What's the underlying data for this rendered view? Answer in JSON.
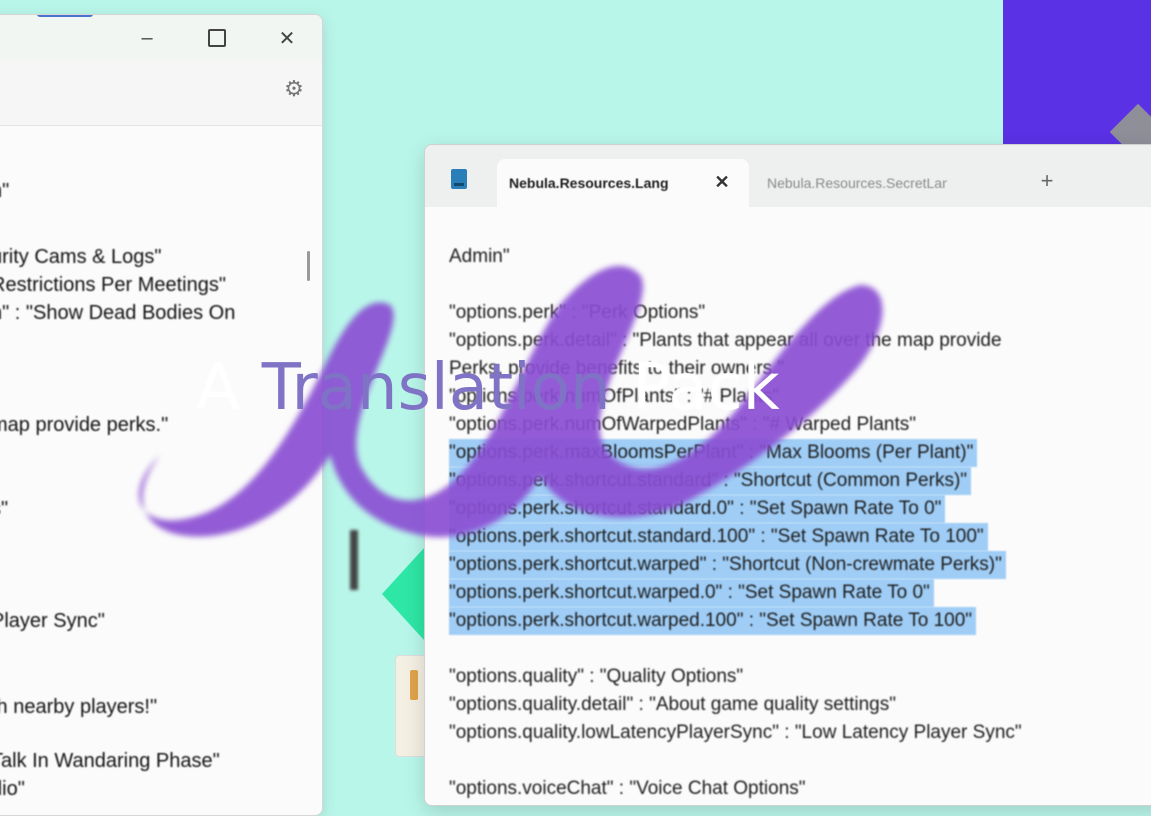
{
  "decor_colors": {
    "background": "#b9f6ea",
    "brush": "#8a4ed3",
    "corner": "#5a31e4"
  },
  "left_window": {
    "minimize_icon": "minimize-icon",
    "maximize_icon": "maximize-icon",
    "close_icon": "close-icon",
    "settings_icon": "gear-icon",
    "lines": [
      "n\"",
      "urity Cams & Logs\"",
      " Restrictions Per Meetings\"",
      "n\" : \"Show Dead Bodies On",
      "map provide perks.\"",
      "s\"",
      "",
      "Player Sync\"",
      "th nearby players!\"",
      "Talk In Wandaring Phase\"",
      "dio\""
    ]
  },
  "right_window": {
    "tabs": [
      {
        "label": "Nebula.Resources.Lang",
        "active": true
      },
      {
        "label": "Nebula.Resources.SecretLang",
        "active": false
      }
    ],
    "add_tab_icon": "plus-icon",
    "lines": [
      {
        "text": "Admin\"",
        "selected": false
      },
      {
        "text": "",
        "selected": false
      },
      {
        "text": "\"options.perk\" : \"Perk Options\"",
        "selected": false
      },
      {
        "text": "\"options.perk.detail\" : \"Plants that appear all over the map provide",
        "selected": false
      },
      {
        "text": "Perks, provide benefits to their owners.\"",
        "selected": false
      },
      {
        "text": "\"options.perk.numOfPlants\" : \"# Plants\"",
        "selected": false
      },
      {
        "text": "\"options.perk.numOfWarpedPlants\" : \"# Warped Plants\"",
        "selected": false
      },
      {
        "text": "\"options.perk.maxBloomsPerPlant\" : \"Max Blooms (Per Plant)\"",
        "selected": true
      },
      {
        "text": "\"options.perk.shortcut.standard\" : \"Shortcut (Common Perks)\"",
        "selected": true
      },
      {
        "text": "\"options.perk.shortcut.standard.0\" : \"Set Spawn Rate To 0\"",
        "selected": true
      },
      {
        "text": "\"options.perk.shortcut.standard.100\" : \"Set Spawn Rate To 100\"",
        "selected": true
      },
      {
        "text": "\"options.perk.shortcut.warped\" : \"Shortcut (Non-crewmate Perks)\"",
        "selected": true
      },
      {
        "text": "\"options.perk.shortcut.warped.0\" : \"Set Spawn Rate To 0\"",
        "selected": true
      },
      {
        "text": "\"options.perk.shortcut.warped.100\" : \"Set Spawn Rate To 100\"",
        "selected": true
      },
      {
        "text": "",
        "selected": false
      },
      {
        "text": "\"options.quality\" : \"Quality Options\"",
        "selected": false
      },
      {
        "text": "\"options.quality.detail\" : \"About game quality settings\"",
        "selected": false
      },
      {
        "text": "\"options.quality.lowLatencyPlayerSync\" : \"Low Latency Player Sync\"",
        "selected": false
      },
      {
        "text": "",
        "selected": false
      },
      {
        "text": "\"options.voiceChat\" : \"Voice Chat Options\"",
        "selected": false
      }
    ]
  },
  "overlay": {
    "word1": "A",
    "word2": "Translation",
    "word3": "Pack"
  }
}
